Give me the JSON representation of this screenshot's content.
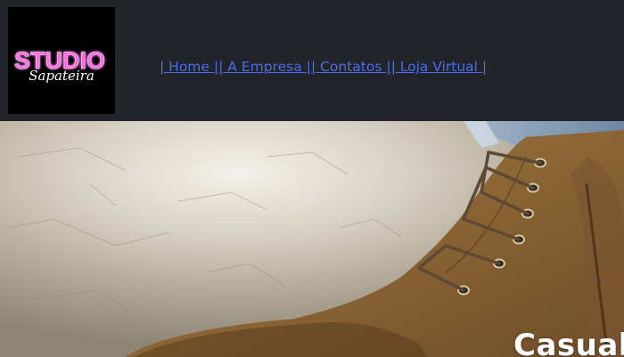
{
  "brand": {
    "logo_text_primary": "STUDIO",
    "logo_text_script": "Sapateira"
  },
  "nav": {
    "items": [
      {
        "label": "Home"
      },
      {
        "label": "A Empresa"
      },
      {
        "label": "Contatos"
      },
      {
        "label": "Loja Virtual"
      }
    ],
    "separator": "|"
  },
  "hero": {
    "title": "Casual"
  },
  "colors": {
    "header_bg": "#212429",
    "link": "#4d6bf0",
    "logo_neon": "#ff4fe0"
  }
}
